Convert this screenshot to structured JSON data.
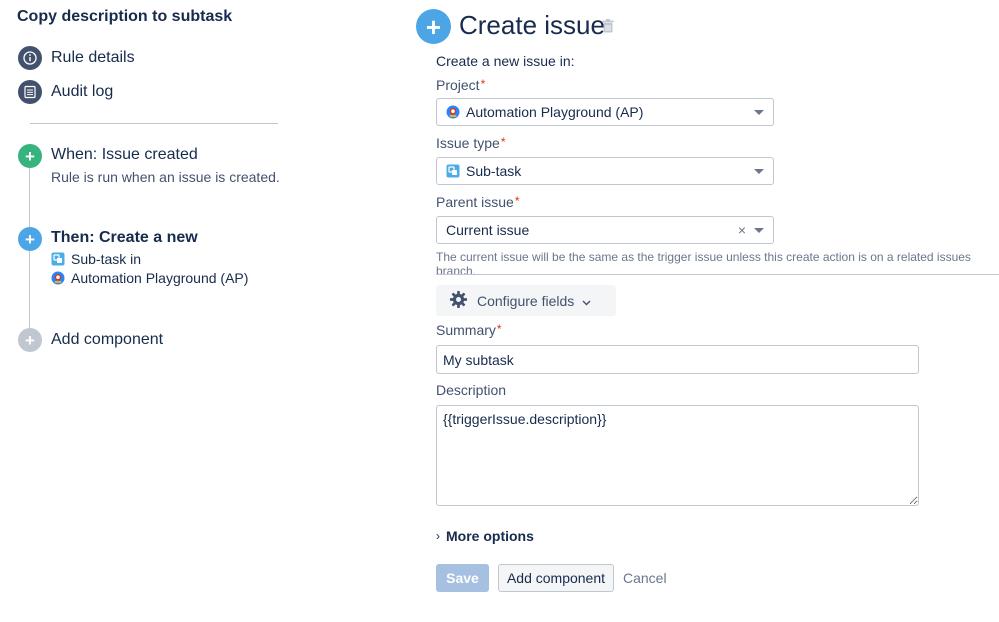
{
  "rule": {
    "title": "Copy description to subtask"
  },
  "sidebar": {
    "nav": [
      {
        "label": "Rule details",
        "icon": "info-icon"
      },
      {
        "label": "Audit log",
        "icon": "list-icon"
      }
    ],
    "components": {
      "trigger": {
        "title": "When: Issue created",
        "subtitle": "Rule is run when an issue is created.",
        "icon": "plus-icon",
        "color": "#36b37e"
      },
      "action": {
        "title": "Then: Create a new",
        "line1": "Sub-task in",
        "line2": "Automation Playground (AP)",
        "icon": "plus-icon",
        "color": "#4ca6e5"
      },
      "add": {
        "label": "Add component",
        "icon": "plus-icon",
        "color": "#c1c7d0"
      }
    }
  },
  "panel": {
    "title": "Create issue",
    "create_in_label": "Create a new issue in:",
    "project": {
      "label": "Project",
      "value": "Automation Playground (AP)"
    },
    "issue_type": {
      "label": "Issue type",
      "value": "Sub-task"
    },
    "parent_issue": {
      "label": "Parent issue",
      "value": "Current issue",
      "clear": "×",
      "help": "The current issue will be the same as the trigger issue unless this create action is on a related issues branch."
    },
    "configure_fields_label": "Configure fields",
    "summary": {
      "label": "Summary",
      "value": "My subtask"
    },
    "description": {
      "label": "Description",
      "value": "{{triggerIssue.description}}"
    },
    "more_options_label": "More options",
    "buttons": {
      "save": "Save",
      "add_component": "Add component",
      "cancel": "Cancel"
    },
    "required_mark": "*"
  }
}
